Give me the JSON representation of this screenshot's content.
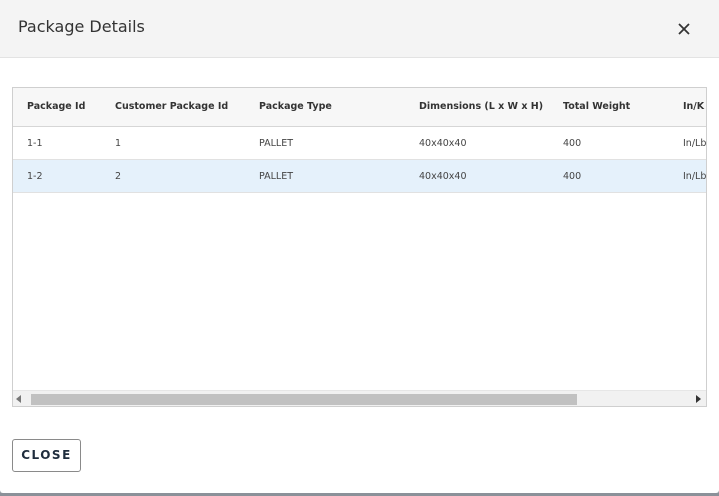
{
  "modal": {
    "title": "Package Details",
    "close_button_label": "CLOSE"
  },
  "table": {
    "columns": [
      "Package Id",
      "Customer Package Id",
      "Package Type",
      "Dimensions (L x W x H)",
      "Total Weight",
      "In/K"
    ],
    "rows": [
      {
        "package_id": "1-1",
        "customer_package_id": "1",
        "package_type": "PALLET",
        "dimensions": "40x40x40",
        "total_weight": "400",
        "units": "In/Lb"
      },
      {
        "package_id": "1-2",
        "customer_package_id": "2",
        "package_type": "PALLET",
        "dimensions": "40x40x40",
        "total_weight": "400",
        "units": "In/Lb"
      }
    ],
    "selected_row": 1
  },
  "icons": {
    "close": "close-icon",
    "scroll_left": "scroll-left-arrow-icon",
    "scroll_right": "scroll-right-arrow-icon"
  },
  "colors": {
    "header_bg": "#f4f4f4",
    "selected_row_bg": "#e5f1fb",
    "button_text": "#1f2d3d"
  }
}
